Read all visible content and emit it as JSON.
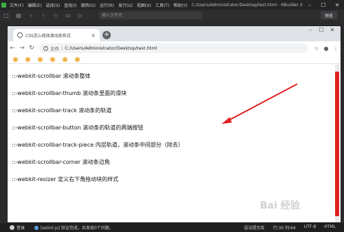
{
  "ide": {
    "menu": [
      "文件(F)",
      "编辑(E)",
      "选择(S)",
      "查找(I)",
      "跳转(G)",
      "运行(R)",
      "发行(U)",
      "视图(V)",
      "工具(T)",
      "帮助(Y)"
    ],
    "window_path": "C:/Users/Administrator/Desktop/test.html - HBuilder X",
    "file_input_placeholder": "输入文件名",
    "preview_label": "预览",
    "controls": [
      "–",
      "☐",
      "✕"
    ]
  },
  "browser": {
    "tab_title": "CSS怎么修改滚动条样式",
    "tab_close": "×",
    "new_tab": "+",
    "url_scheme": "文件",
    "url_sep": "|",
    "url": "C:/Users/Administrator/Desktop/test.html",
    "window_controls": [
      "–",
      "☐",
      "✕"
    ],
    "bookmarks": [
      "",
      "",
      "",
      "",
      "",
      ""
    ]
  },
  "content": {
    "lines": [
      "::-webkit-scrollbar 滚动条整体",
      "::-webkit-scrollbar-thumb 滚动条里面的滑块",
      "::-webkit-scrollbar-track 滚动条的轨道",
      "::-webkit-scrollbar-button 滚动条的轨道的两端按钮",
      "::-webkit-scrollbar-track-piece 内层轨道，滚动条中间部分（除去）",
      "::-webkit-scrollbar-corner 滚动条边角",
      "::-webkit-resizer 定义右下角拖动块的样式"
    ]
  },
  "annotation": {
    "arrow_color": "#e02020"
  },
  "scrollbar": {
    "thumb_color": "#e02020",
    "track_color": "#e9e9e9"
  },
  "watermark": "Bai 经验",
  "statusbar": {
    "login": "登录",
    "message": "[eslint-js] 验证完成，共发现0个问题。",
    "encoding_mode": "语法提示库",
    "position": "行:30 列:64",
    "encoding": "UTF-8",
    "language": "HTML"
  }
}
